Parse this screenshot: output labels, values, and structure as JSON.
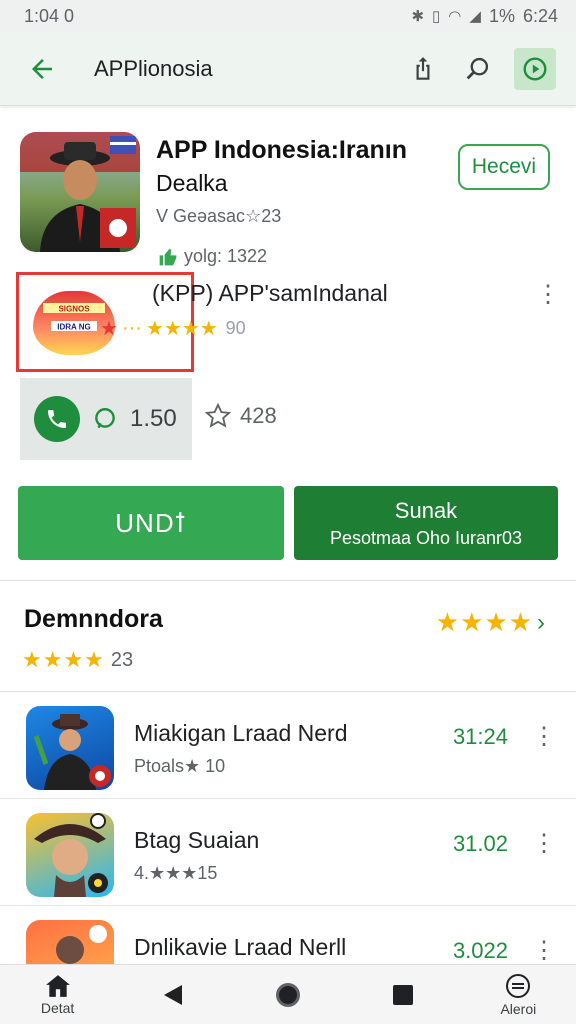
{
  "status": {
    "time": "1:04 0",
    "battery": "1%",
    "clock": "6:24"
  },
  "app_bar": {
    "title": "APPlionosia"
  },
  "hero": {
    "title_line1": "APP Indonesia:Iranın",
    "title_line2": "Dealka",
    "subtitle": "V Geəasac☆23",
    "rating_label": "yolg: 1322",
    "action_button": "Hecevi"
  },
  "featured": {
    "badge_line1": "SIGNOS",
    "badge_line2": "IDRA NG",
    "title": "(KPP) APP'samIndanal",
    "rating_value": "90"
  },
  "stats": {
    "value": "1.50",
    "star_value": "428"
  },
  "buttons": {
    "install": "UNDꝉ",
    "secondary_line1": "Sunak",
    "secondary_line2": "Pesotmaa Oho Iuranr03"
  },
  "section": {
    "title": "Demnndora",
    "stars": "★★★★",
    "rating_value": "23"
  },
  "list": [
    {
      "title": "Miakigan Lraad Nerd",
      "subtitle": "Ptoals★ 10",
      "price": "31:24"
    },
    {
      "title": "Btag Suaian",
      "subtitle": "4.★★★15",
      "price": "31.02"
    },
    {
      "title": "Dnlikavie Lraad Nerll",
      "subtitle": "",
      "price": "3.022"
    }
  ],
  "nav": {
    "home_label": "Detat",
    "alerts_label": "Aleroi"
  },
  "colors": {
    "accent": "#34a853",
    "accent_dark": "#1e7e34",
    "star": "#f4b400",
    "highlight": "#e53935"
  }
}
